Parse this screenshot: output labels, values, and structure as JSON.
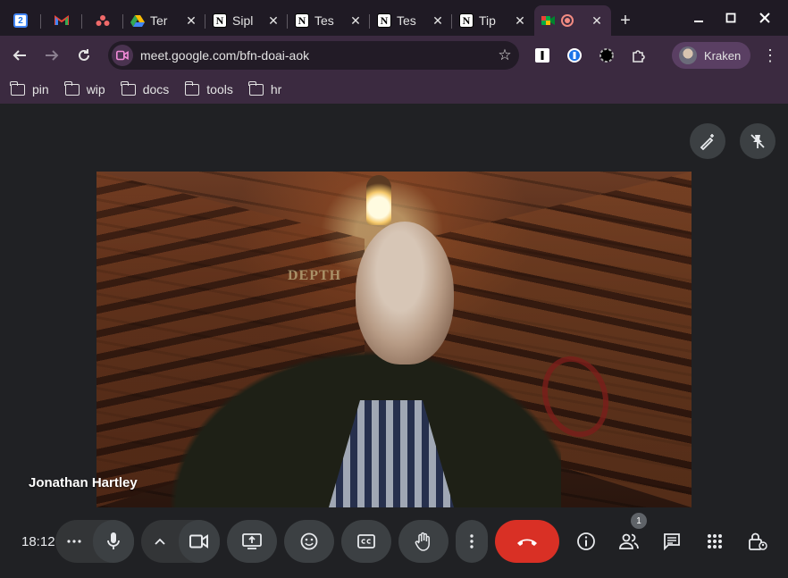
{
  "browser": {
    "tabs": [
      {
        "id": "calendar",
        "title": "",
        "icon": "calendar-icon"
      },
      {
        "id": "gmail",
        "title": "",
        "icon": "gmail-icon"
      },
      {
        "id": "asana",
        "title": "",
        "icon": "asana-icon"
      },
      {
        "id": "drive",
        "title": "Ter",
        "icon": "google-drive-icon"
      },
      {
        "id": "notion1",
        "title": "Sipl",
        "icon": "notion-icon"
      },
      {
        "id": "notion2",
        "title": "Tes",
        "icon": "notion-icon"
      },
      {
        "id": "notion3",
        "title": "Tes",
        "icon": "notion-icon"
      },
      {
        "id": "notion4",
        "title": "Tip",
        "icon": "notion-icon"
      },
      {
        "id": "meet",
        "title": "",
        "icon": "google-meet-icon",
        "active": true
      }
    ],
    "calendar_day": "2",
    "notion_letter": "N",
    "url": "meet.google.com/bfn-doai-aok",
    "profile_name": "Kraken",
    "bookmarks": [
      "pin",
      "wip",
      "docs",
      "tools",
      "hr"
    ]
  },
  "meeting": {
    "participant_name": "Jonathan Hartley",
    "scene_sign": "DEPTH",
    "clock": "18:12",
    "participants_count": "1"
  },
  "colors": {
    "end_call": "#d93025",
    "toolbar": "#3b2a40",
    "meet_bg": "#202124"
  }
}
